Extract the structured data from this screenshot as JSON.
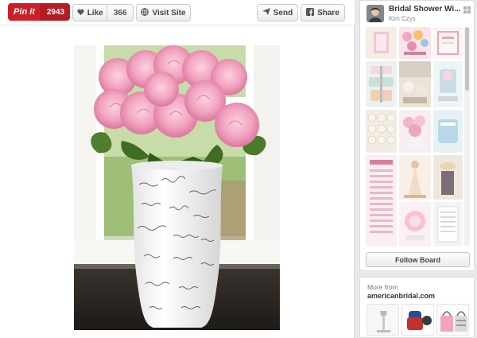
{
  "toolbar": {
    "pin_label": "Pin it",
    "pin_count": "2943",
    "like_label": "Like",
    "like_count": "366",
    "visit_label": "Visit Site",
    "send_label": "Send",
    "share_label": "Share"
  },
  "board": {
    "title": "Bridal Shower Wi...",
    "owner": "Kim Czys",
    "follow_label": "Follow Board"
  },
  "more_from": {
    "label": "More from",
    "domain": "americanbridal.com"
  },
  "colors": {
    "pin_red": "#cb2027",
    "rose_pink": "#f2a9c4",
    "vase_white": "#fafafa"
  }
}
